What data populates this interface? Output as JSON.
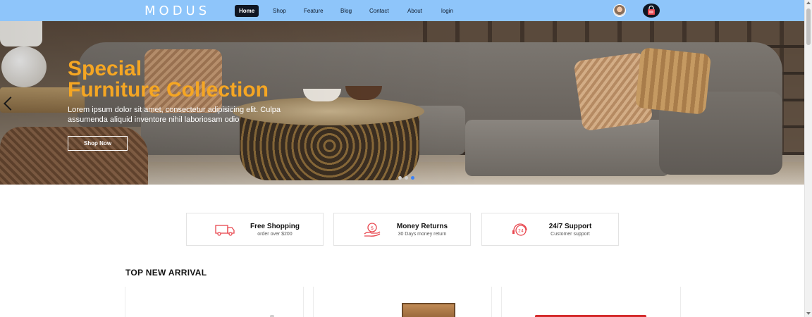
{
  "brand": {
    "logo": "MODUS"
  },
  "nav": {
    "items": [
      {
        "label": "Home",
        "active": true
      },
      {
        "label": "Shop",
        "active": false
      },
      {
        "label": "Feature",
        "active": false
      },
      {
        "label": "Blog",
        "active": false
      },
      {
        "label": "Contact",
        "active": false
      },
      {
        "label": "About",
        "active": false
      },
      {
        "label": "login",
        "active": false
      }
    ],
    "icons": [
      "user-avatar",
      "shopping-bag-icon"
    ]
  },
  "hero": {
    "title_line1": "Special",
    "title_line2": "Furniture Collection",
    "description": "Lorem ipsum dolor sit amet, consectetur adipisicing elit. Culpa assumenda aliquid inventore nihil laboriosam odio",
    "button_label": "Shop Now",
    "slides": 3,
    "active_slide": 2
  },
  "features": [
    {
      "title": "Free Shopping",
      "subtitle": "order over $200",
      "icon": "truck-icon"
    },
    {
      "title": "Money Returns",
      "subtitle": "30 Days money return",
      "icon": "money-hand-icon"
    },
    {
      "title": "24/7 Support",
      "subtitle": "Customer support",
      "icon": "support-24-icon"
    }
  ],
  "section": {
    "title": "TOP NEW ARRIVAL"
  },
  "colors": {
    "navbar": "#8ec5fa",
    "accent": "#f5a623",
    "feature_icon": "#e8474f",
    "dark": "#0f1622"
  }
}
